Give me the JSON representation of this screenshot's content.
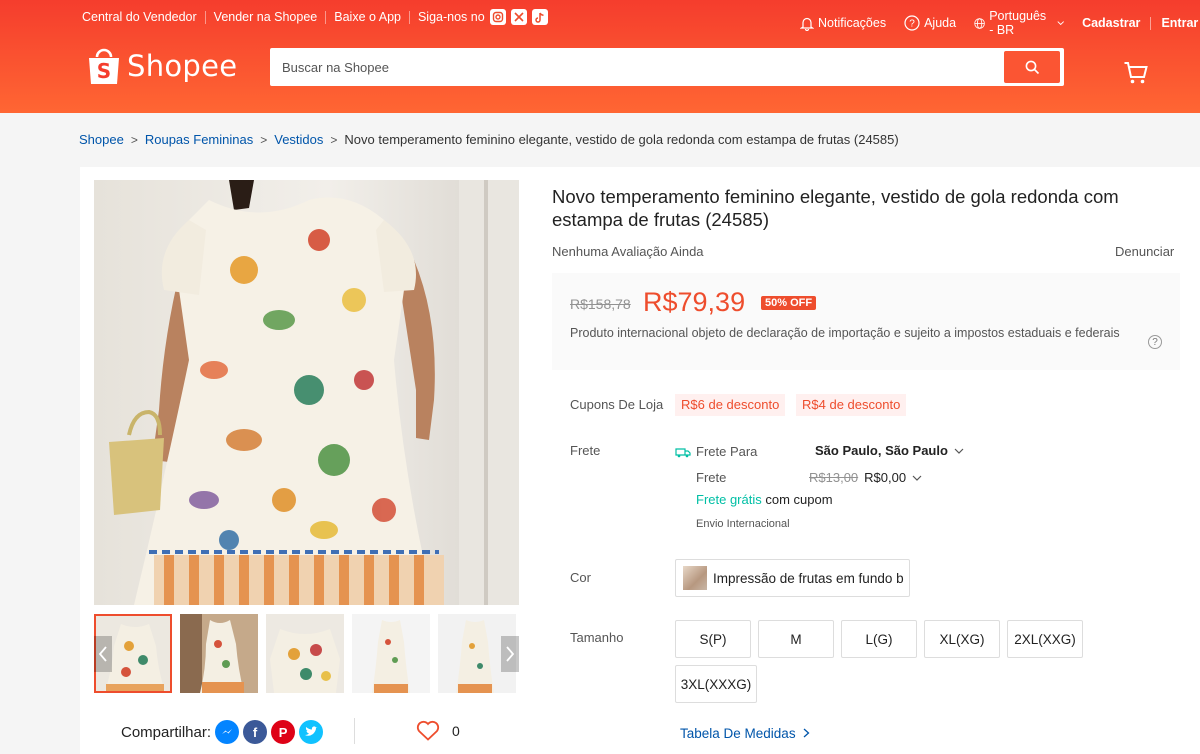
{
  "topbar": {
    "seller_center": "Central do Vendedor",
    "sell": "Vender na Shopee",
    "download": "Baixe o App",
    "follow": "Siga-nos no",
    "notifications": "Notificações",
    "help": "Ajuda",
    "language": "Português - BR",
    "signup": "Cadastrar",
    "login": "Entrar"
  },
  "header": {
    "logo": "Shopee",
    "search_placeholder": "Buscar na Shopee"
  },
  "breadcrumb": {
    "items": [
      "Shopee",
      "Roupas Femininas",
      "Vestidos"
    ],
    "current": "Novo temperamento feminino elegante, vestido de gola redonda com estampa de frutas (24585)"
  },
  "product": {
    "title": "Novo temperamento feminino elegante, vestido de gola redonda com estampa de frutas (24585)",
    "rating": "Nenhuma Avaliação Ainda",
    "report": "Denunciar",
    "old_price": "R$158,78",
    "price": "R$79,39",
    "discount": "50% OFF",
    "tax_note": "Produto internacional objeto de declaração de importação e sujeito a impostos estaduais e federais",
    "help_mark": "?"
  },
  "coupons": {
    "label": "Cupons De Loja",
    "items": [
      "R$6 de desconto",
      "R$4 de desconto"
    ]
  },
  "shipping": {
    "label": "Frete",
    "ship_to_label": "Frete Para",
    "ship_to": "São Paulo, São Paulo",
    "fee_label": "Frete",
    "old_fee": "R$13,00",
    "fee": "R$0,00",
    "free_shipping": "Frete grátis",
    "with_coupon": "com cupom",
    "international": "Envio Internacional"
  },
  "variation": {
    "color_label": "Cor",
    "color_value": "Impressão de frutas em fundo b",
    "size_label": "Tamanho",
    "sizes": [
      "S(P)",
      "M",
      "L(G)",
      "XL(XG)",
      "2XL(XXG)",
      "3XL(XXXG)"
    ],
    "size_table": "Tabela De Medidas"
  },
  "share": {
    "label": "Compartilhar:",
    "likes": "0"
  },
  "colors": {
    "brand": "#ee4d2d",
    "link": "#0055aa",
    "free_shipping": "#00bfa5"
  }
}
